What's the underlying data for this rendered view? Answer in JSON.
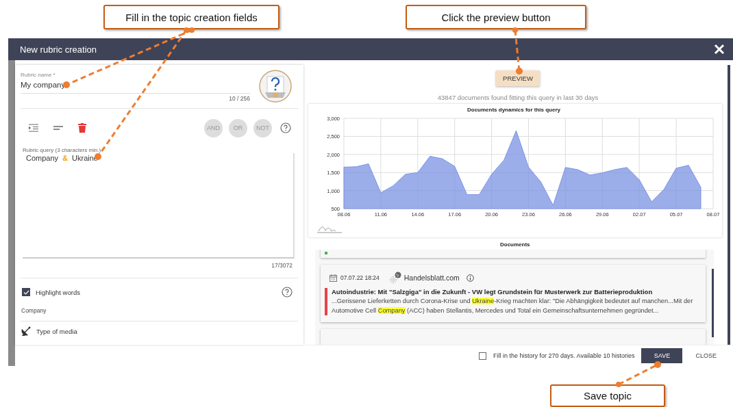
{
  "annotations": [
    {
      "text": "Fill in the topic creation fields"
    },
    {
      "text": "Click the preview button"
    },
    {
      "text": "Save topic"
    }
  ],
  "dialog": {
    "title": "New rubric creation"
  },
  "rubric_name": {
    "label": "Rubric name *",
    "value": "My company",
    "counter": "10 / 256"
  },
  "operators": [
    {
      "label": "AND",
      "disabled": true
    },
    {
      "label": "OR",
      "disabled": true
    },
    {
      "label": "NOT",
      "disabled": true
    }
  ],
  "query": {
    "label": "Rubric query (3 characters min.)",
    "tokens": [
      {
        "kind": "word",
        "text": "Company"
      },
      {
        "kind": "operator",
        "text": "&"
      },
      {
        "kind": "word",
        "text": "Ukraine"
      }
    ],
    "counter": "17/3072"
  },
  "highlight": {
    "label": "Highlight words",
    "checked": true,
    "words": "Company"
  },
  "media_filter": {
    "label": "Type of media"
  },
  "preview_button": "PREVIEW",
  "result_summary": "43847 documents found fitting this query in last 30 days",
  "chart": {
    "chart_data": {
      "type": "area",
      "title": "Documents dynamics for this query",
      "categories": [
        "08.06",
        null,
        null,
        "11.06",
        null,
        null,
        "14.06",
        null,
        null,
        "17.06",
        null,
        null,
        "20.06",
        null,
        null,
        "23.06",
        null,
        null,
        "26.06",
        null,
        null,
        "29.06",
        null,
        null,
        "02.07",
        null,
        null,
        "05.07",
        null,
        null,
        "08.07"
      ],
      "grid": true,
      "series": [
        {
          "color": "#7b93e3",
          "values": [
            1650,
            1660,
            1740,
            940,
            1130,
            1450,
            1500,
            1950,
            1880,
            1670,
            890,
            890,
            1450,
            1840,
            2660,
            1650,
            1240,
            590,
            1640,
            1580,
            1430,
            1490,
            1580,
            1640,
            1300,
            690,
            1030,
            1620,
            1700,
            1090,
            null
          ]
        }
      ],
      "ylim": [
        500,
        3000
      ],
      "yticks": [
        {
          "value": 500,
          "label": "500"
        },
        {
          "value": 1000,
          "label": "1,000"
        },
        {
          "value": 1500,
          "label": "1,500"
        },
        {
          "value": 2000,
          "label": "2,000"
        },
        {
          "value": 2500,
          "label": "2,500"
        },
        {
          "value": 3000,
          "label": "3,000"
        }
      ]
    }
  },
  "documents": {
    "title": "Documents",
    "items": [
      {
        "kind": "tail",
        "color": "#4caf50"
      },
      {
        "kind": "full",
        "color": "#e8414b",
        "date": "07.07.22 18:24",
        "source": "Handelsblatt.com",
        "title": "Autoindustrie: Mit \"Salzgiga\" in die Zukunft - VW legt Grundstein für Musterwerk zur Batterieproduktion",
        "snippet": [
          {
            "text": "...Gerissene Lieferketten durch Corona-Krise und ",
            "highlight": false
          },
          {
            "text": "Ukraine",
            "highlight": true
          },
          {
            "text": "-Krieg machten klar: \"Die Abhängigkeit bedeutet auf manchen...Mit der Automotive Cell ",
            "highlight": false
          },
          {
            "text": "Company",
            "highlight": true
          },
          {
            "text": " (ACC) haben Stellantis, Mercedes und Total ein Gemeinschaftsunternehmen gegründet...",
            "highlight": false
          }
        ]
      },
      {
        "kind": "head"
      }
    ]
  },
  "footer": {
    "history": {
      "label": "Fill in the history for 270 days. Available 10 histories",
      "checked": false
    },
    "buttons": [
      {
        "label": "SAVE",
        "kind": "primary"
      },
      {
        "label": "CLOSE",
        "kind": "text"
      }
    ]
  }
}
